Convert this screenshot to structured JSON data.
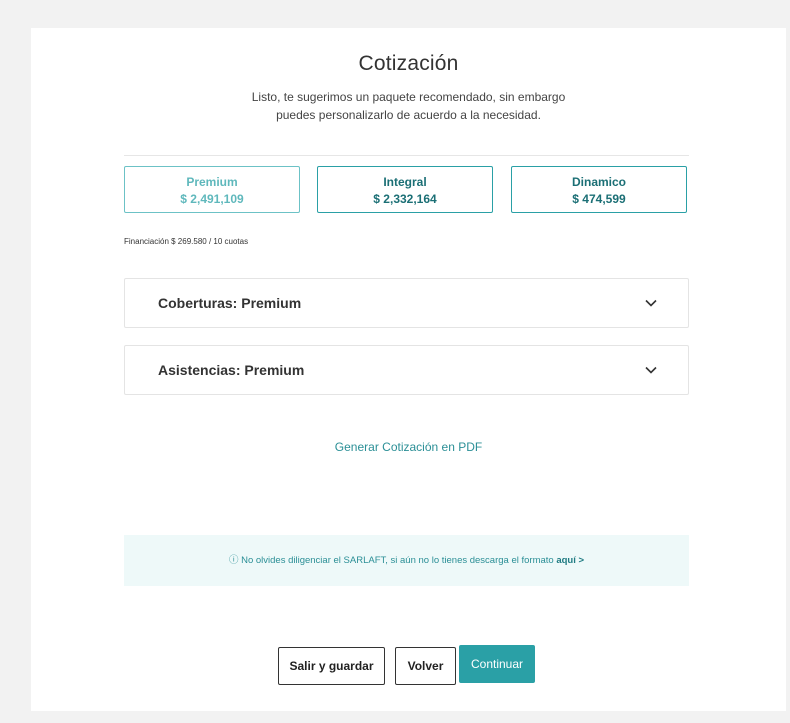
{
  "header": {
    "title": "Cotización",
    "subtitle_line1": "Listo, te sugerimos un paquete recomendado, sin embargo",
    "subtitle_line2": "puedes personalizarlo de acuerdo a la necesidad."
  },
  "plans": [
    {
      "name": "Premium",
      "price": "$ 2,491,109",
      "selected": true
    },
    {
      "name": "Integral",
      "price": "$ 2,332,164",
      "selected": false
    },
    {
      "name": "Dinamico",
      "price": "$ 474,599",
      "selected": false
    }
  ],
  "financing": "Financiación $ 269.580 / 10 cuotas",
  "accordions": [
    {
      "label": "Coberturas: Premium",
      "icon": "chevron-down-icon"
    },
    {
      "label": "Asistencias: Premium",
      "icon": "chevron-down-icon"
    }
  ],
  "pdf_link": "Generar Cotización en PDF",
  "notice": {
    "icon": "info-icon",
    "icon_glyph": "ⓘ",
    "text": "No olvides diligenciar el SARLAFT, si aún no lo tienes descarga el formato",
    "link": "aquí >"
  },
  "buttons": {
    "save_exit": "Salir y guardar",
    "back": "Volver",
    "continue": "Continuar"
  },
  "colors": {
    "accent": "#2aa0a6",
    "notice_bg": "#eef9f9",
    "page_bg": "#f2f2f2"
  }
}
